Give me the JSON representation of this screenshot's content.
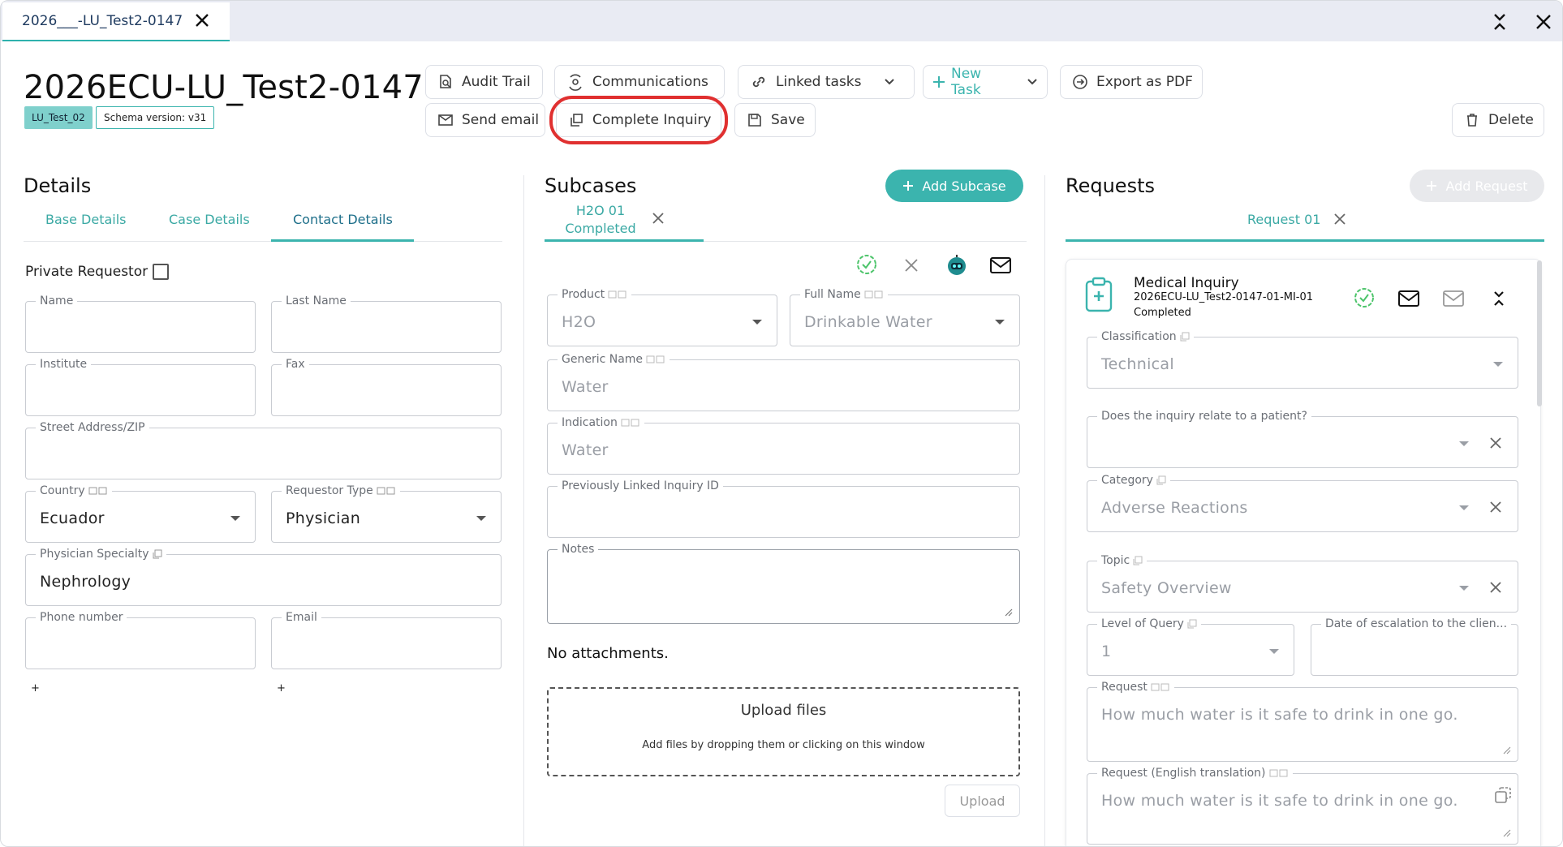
{
  "window": {
    "tab_title": "2026___-LU_Test2-0147"
  },
  "header": {
    "case_title": "2026ECU-LU_Test2-0147",
    "chip_team": "LU_Test_02",
    "chip_schema": "Schema version: v31"
  },
  "toolbar": {
    "audit_trail": "Audit Trail",
    "communications": "Communications",
    "linked_tasks": "Linked tasks",
    "new_task": "New Task",
    "export_pdf": "Export as PDF",
    "send_email": "Send email",
    "complete_inquiry": "Complete Inquiry",
    "save": "Save",
    "delete": "Delete"
  },
  "details": {
    "title": "Details",
    "tabs": [
      "Base Details",
      "Case Details",
      "Contact Details"
    ],
    "private_requestor": "Private Requestor",
    "fields": {
      "name": {
        "label": "Name",
        "value": ""
      },
      "last_name": {
        "label": "Last Name",
        "value": ""
      },
      "institute": {
        "label": "Institute",
        "value": ""
      },
      "fax": {
        "label": "Fax",
        "value": ""
      },
      "street": {
        "label": "Street Address/ZIP",
        "value": ""
      },
      "country": {
        "label": "Country",
        "value": "Ecuador"
      },
      "requestor_type": {
        "label": "Requestor Type",
        "value": "Physician"
      },
      "specialty": {
        "label": "Physician Specialty",
        "value": "Nephrology"
      },
      "phone": {
        "label": "Phone number",
        "value": ""
      },
      "email": {
        "label": "Email",
        "value": ""
      }
    },
    "plus": "+"
  },
  "subcases": {
    "title": "Subcases",
    "add_button": "Add Subcase",
    "tab_line1": "H2O 01",
    "tab_line2": "Completed",
    "fields": {
      "product": {
        "label": "Product",
        "value": "H2O"
      },
      "full_name": {
        "label": "Full Name",
        "value": "Drinkable Water"
      },
      "generic_name": {
        "label": "Generic Name",
        "value": "Water"
      },
      "indication": {
        "label": "Indication",
        "value": "Water"
      },
      "prev_linked": {
        "label": "Previously Linked Inquiry ID",
        "value": ""
      },
      "notes": {
        "label": "Notes",
        "value": ""
      }
    },
    "no_attachments": "No attachments.",
    "upload_title": "Upload files",
    "upload_hint": "Add files by dropping them or clicking on this window",
    "upload_button": "Upload"
  },
  "requests": {
    "title": "Requests",
    "add_button": "Add Request",
    "tab": "Request 01",
    "card": {
      "type": "Medical Inquiry",
      "id": "2026ECU-LU_Test2-0147-01-MI-01",
      "status": "Completed"
    },
    "fields": {
      "classification": {
        "label": "Classification",
        "value": "Technical"
      },
      "relates_patient": {
        "label": "Does the inquiry relate to a patient?",
        "value": ""
      },
      "category": {
        "label": "Category",
        "value": "Adverse Reactions"
      },
      "topic": {
        "label": "Topic",
        "value": "Safety Overview"
      },
      "level": {
        "label": "Level of Query",
        "value": "1"
      },
      "escalation": {
        "label": "Date of escalation to the clien...",
        "value": ""
      },
      "request": {
        "label": "Request",
        "value": "How much water is it safe to drink in one go."
      },
      "request_en": {
        "label": "Request (English translation)",
        "value": "How much water is it safe to drink in one go."
      }
    }
  },
  "colors": {
    "accent": "#3bb4ae",
    "highlight": "#e03030",
    "chip_team_bg": "#7fd0cc"
  }
}
